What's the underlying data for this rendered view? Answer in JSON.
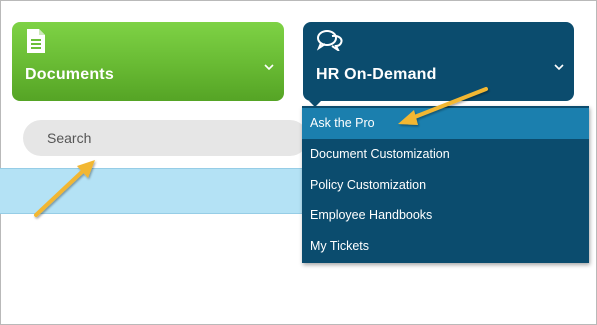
{
  "tiles": {
    "documents": {
      "label": "Documents",
      "icon": "document-icon",
      "color": "#6cbf38"
    },
    "hr": {
      "label": "HR On-Demand",
      "icon": "chat-bubbles-icon",
      "color": "#0b4c6e"
    }
  },
  "search": {
    "placeholder": "Search"
  },
  "dropdown": {
    "items": [
      {
        "label": "Ask the Pro",
        "active": true
      },
      {
        "label": "Document Customization"
      },
      {
        "label": "Policy Customization"
      },
      {
        "label": "Employee Handbooks"
      },
      {
        "label": "My Tickets"
      }
    ],
    "active_color": "#1b7fae"
  },
  "annotations": {
    "arrow_color": "#f2b732"
  }
}
